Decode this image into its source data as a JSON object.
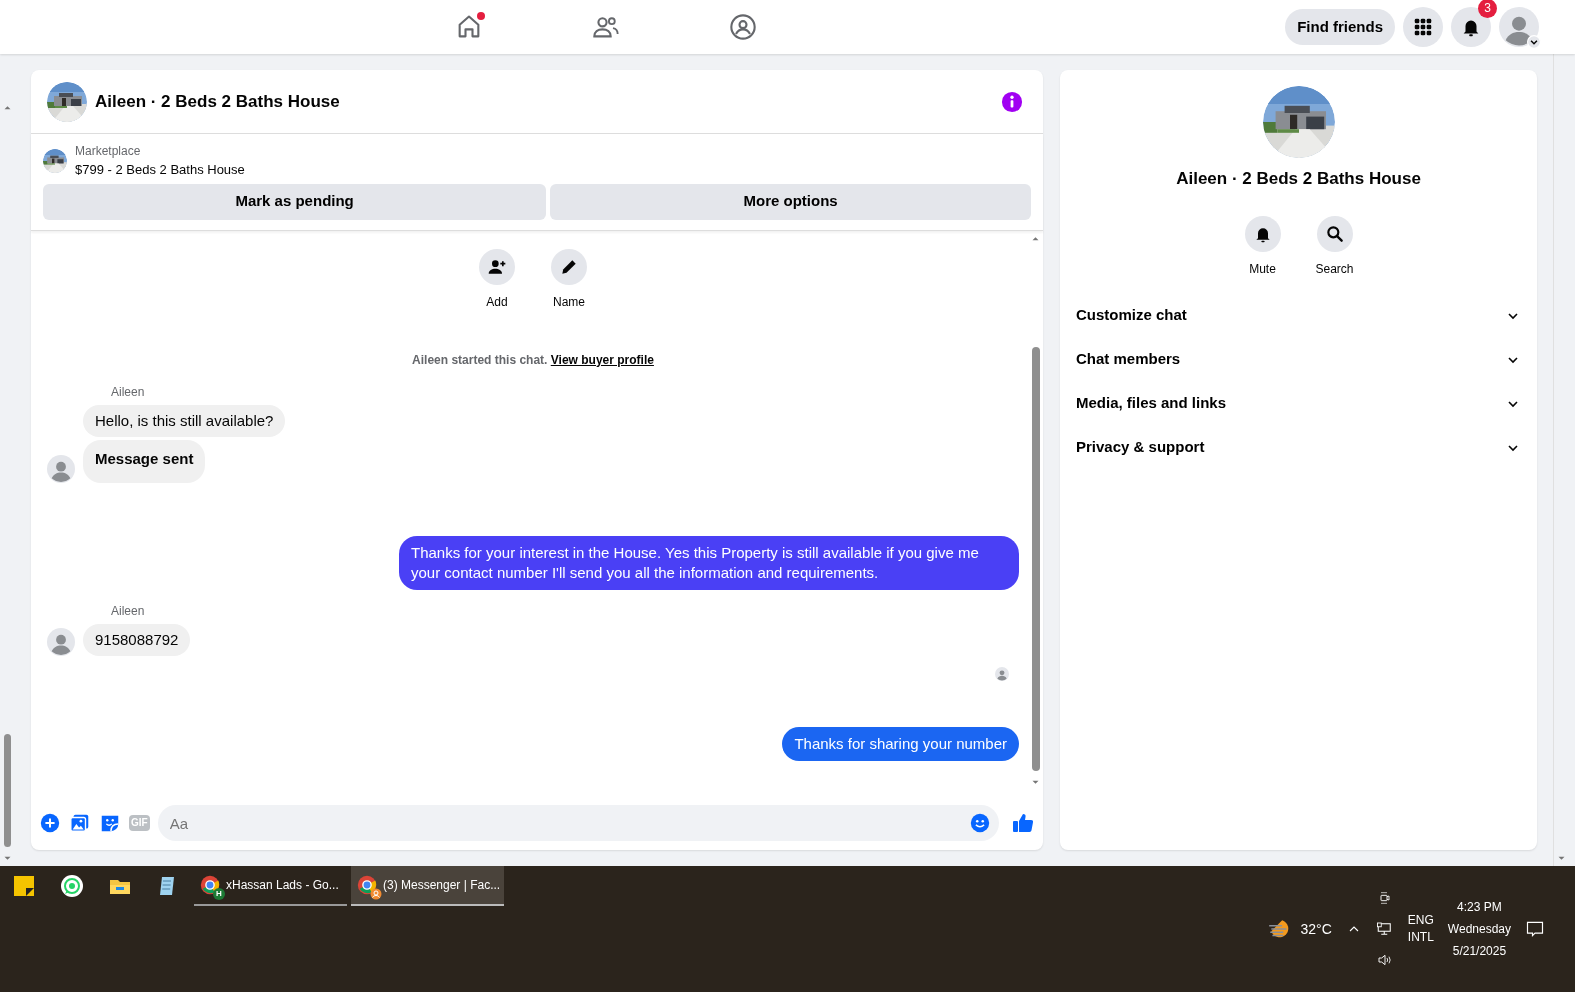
{
  "top_nav": {
    "tabs": [
      {
        "notification_dot": true
      },
      {
        "notification_dot": false
      },
      {
        "notification_dot": false
      }
    ],
    "find_friends": "Find friends",
    "notifications_badge": "3"
  },
  "chat": {
    "title": "Aileen · 2 Beds 2 Baths House",
    "listing": {
      "source": "Marketplace",
      "text": "$799 - 2 Beds 2 Baths House"
    },
    "buttons": [
      "Mark as pending",
      "More options"
    ],
    "actions": [
      {
        "label": "Add"
      },
      {
        "label": "Name"
      }
    ],
    "started": {
      "text": "Aileen started this chat.",
      "link": "View buyer profile"
    },
    "messages": [
      {
        "kind": "incoming",
        "sender": "Aileen",
        "bubbles": [
          {
            "text": "Hello, is this still available?",
            "bold": false
          },
          {
            "text": "Message sent",
            "bold": true
          }
        ]
      },
      {
        "kind": "outgoing",
        "color": "#4a40f5",
        "text": "Thanks for your interest in the House. Yes this Property is still available if you give me your contact number I'll send you all the information and requirements."
      },
      {
        "kind": "incoming",
        "sender": "Aileen",
        "bubbles": [
          {
            "text": "9158088792",
            "bold": false
          }
        ]
      },
      {
        "kind": "seen"
      },
      {
        "kind": "outgoing",
        "color": "#1b66f2",
        "text": "Thanks for sharing your number"
      }
    ],
    "composer": {
      "gif": "GIF",
      "placeholder": "Aa"
    }
  },
  "details": {
    "title": "Aileen · 2 Beds 2 Baths House",
    "actions": [
      {
        "label": "Mute"
      },
      {
        "label": "Search"
      }
    ],
    "sections": [
      {
        "label": "Customize chat",
        "expanded": false
      },
      {
        "label": "Chat members",
        "expanded": false
      },
      {
        "label": "Media, files and links",
        "expanded": false
      },
      {
        "label": "Privacy & support",
        "expanded": false
      }
    ]
  },
  "taskbar": {
    "windows": [
      {
        "label": "xHassan Lads - Go...",
        "badge": "H",
        "selected": false
      },
      {
        "label": "(3) Messenger | Fac...",
        "selected": true
      }
    ],
    "weather": "32°C",
    "language": [
      "ENG",
      "INTL"
    ],
    "time": "4:23 PM",
    "day": "Wednesday",
    "date": "5/21/2025"
  }
}
